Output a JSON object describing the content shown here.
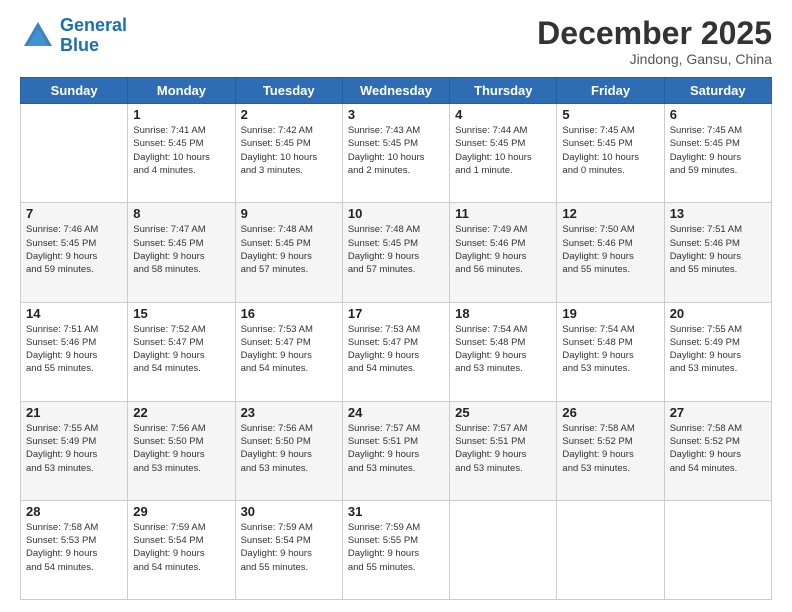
{
  "logo": {
    "line1": "General",
    "line2": "Blue"
  },
  "header": {
    "month": "December 2025",
    "location": "Jindong, Gansu, China"
  },
  "weekdays": [
    "Sunday",
    "Monday",
    "Tuesday",
    "Wednesday",
    "Thursday",
    "Friday",
    "Saturday"
  ],
  "weeks": [
    [
      {
        "day": "",
        "info": ""
      },
      {
        "day": "1",
        "info": "Sunrise: 7:41 AM\nSunset: 5:45 PM\nDaylight: 10 hours\nand 4 minutes."
      },
      {
        "day": "2",
        "info": "Sunrise: 7:42 AM\nSunset: 5:45 PM\nDaylight: 10 hours\nand 3 minutes."
      },
      {
        "day": "3",
        "info": "Sunrise: 7:43 AM\nSunset: 5:45 PM\nDaylight: 10 hours\nand 2 minutes."
      },
      {
        "day": "4",
        "info": "Sunrise: 7:44 AM\nSunset: 5:45 PM\nDaylight: 10 hours\nand 1 minute."
      },
      {
        "day": "5",
        "info": "Sunrise: 7:45 AM\nSunset: 5:45 PM\nDaylight: 10 hours\nand 0 minutes."
      },
      {
        "day": "6",
        "info": "Sunrise: 7:45 AM\nSunset: 5:45 PM\nDaylight: 9 hours\nand 59 minutes."
      }
    ],
    [
      {
        "day": "7",
        "info": "Sunrise: 7:46 AM\nSunset: 5:45 PM\nDaylight: 9 hours\nand 59 minutes."
      },
      {
        "day": "8",
        "info": "Sunrise: 7:47 AM\nSunset: 5:45 PM\nDaylight: 9 hours\nand 58 minutes."
      },
      {
        "day": "9",
        "info": "Sunrise: 7:48 AM\nSunset: 5:45 PM\nDaylight: 9 hours\nand 57 minutes."
      },
      {
        "day": "10",
        "info": "Sunrise: 7:48 AM\nSunset: 5:45 PM\nDaylight: 9 hours\nand 57 minutes."
      },
      {
        "day": "11",
        "info": "Sunrise: 7:49 AM\nSunset: 5:46 PM\nDaylight: 9 hours\nand 56 minutes."
      },
      {
        "day": "12",
        "info": "Sunrise: 7:50 AM\nSunset: 5:46 PM\nDaylight: 9 hours\nand 55 minutes."
      },
      {
        "day": "13",
        "info": "Sunrise: 7:51 AM\nSunset: 5:46 PM\nDaylight: 9 hours\nand 55 minutes."
      }
    ],
    [
      {
        "day": "14",
        "info": "Sunrise: 7:51 AM\nSunset: 5:46 PM\nDaylight: 9 hours\nand 55 minutes."
      },
      {
        "day": "15",
        "info": "Sunrise: 7:52 AM\nSunset: 5:47 PM\nDaylight: 9 hours\nand 54 minutes."
      },
      {
        "day": "16",
        "info": "Sunrise: 7:53 AM\nSunset: 5:47 PM\nDaylight: 9 hours\nand 54 minutes."
      },
      {
        "day": "17",
        "info": "Sunrise: 7:53 AM\nSunset: 5:47 PM\nDaylight: 9 hours\nand 54 minutes."
      },
      {
        "day": "18",
        "info": "Sunrise: 7:54 AM\nSunset: 5:48 PM\nDaylight: 9 hours\nand 53 minutes."
      },
      {
        "day": "19",
        "info": "Sunrise: 7:54 AM\nSunset: 5:48 PM\nDaylight: 9 hours\nand 53 minutes."
      },
      {
        "day": "20",
        "info": "Sunrise: 7:55 AM\nSunset: 5:49 PM\nDaylight: 9 hours\nand 53 minutes."
      }
    ],
    [
      {
        "day": "21",
        "info": "Sunrise: 7:55 AM\nSunset: 5:49 PM\nDaylight: 9 hours\nand 53 minutes."
      },
      {
        "day": "22",
        "info": "Sunrise: 7:56 AM\nSunset: 5:50 PM\nDaylight: 9 hours\nand 53 minutes."
      },
      {
        "day": "23",
        "info": "Sunrise: 7:56 AM\nSunset: 5:50 PM\nDaylight: 9 hours\nand 53 minutes."
      },
      {
        "day": "24",
        "info": "Sunrise: 7:57 AM\nSunset: 5:51 PM\nDaylight: 9 hours\nand 53 minutes."
      },
      {
        "day": "25",
        "info": "Sunrise: 7:57 AM\nSunset: 5:51 PM\nDaylight: 9 hours\nand 53 minutes."
      },
      {
        "day": "26",
        "info": "Sunrise: 7:58 AM\nSunset: 5:52 PM\nDaylight: 9 hours\nand 53 minutes."
      },
      {
        "day": "27",
        "info": "Sunrise: 7:58 AM\nSunset: 5:52 PM\nDaylight: 9 hours\nand 54 minutes."
      }
    ],
    [
      {
        "day": "28",
        "info": "Sunrise: 7:58 AM\nSunset: 5:53 PM\nDaylight: 9 hours\nand 54 minutes."
      },
      {
        "day": "29",
        "info": "Sunrise: 7:59 AM\nSunset: 5:54 PM\nDaylight: 9 hours\nand 54 minutes."
      },
      {
        "day": "30",
        "info": "Sunrise: 7:59 AM\nSunset: 5:54 PM\nDaylight: 9 hours\nand 55 minutes."
      },
      {
        "day": "31",
        "info": "Sunrise: 7:59 AM\nSunset: 5:55 PM\nDaylight: 9 hours\nand 55 minutes."
      },
      {
        "day": "",
        "info": ""
      },
      {
        "day": "",
        "info": ""
      },
      {
        "day": "",
        "info": ""
      }
    ]
  ]
}
